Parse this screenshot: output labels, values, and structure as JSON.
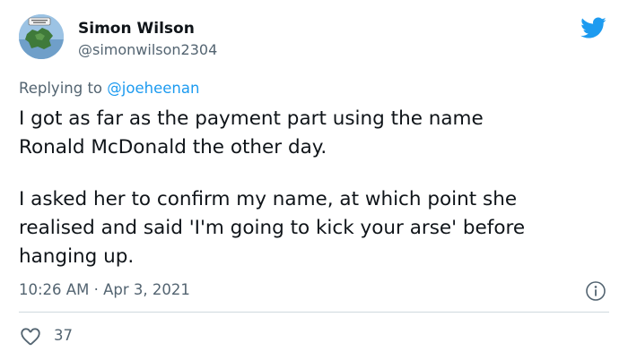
{
  "author": {
    "display_name": "Simon Wilson",
    "handle": "@simonwilson2304"
  },
  "reply": {
    "prefix": "Replying to",
    "mention": "@joeheenan"
  },
  "body": {
    "lines": [
      "I got as far as the payment part using the name",
      "Ronald McDonald the other day.",
      "I asked her to confirm my name, at which point she",
      "realised and said 'I'm going to kick your arse' before",
      "hanging up."
    ]
  },
  "meta": {
    "time": "10:26 AM",
    "separator": "·",
    "date": "Apr 3, 2021"
  },
  "stats": {
    "likes": "37"
  },
  "icons": {
    "brand": "twitter-bird-icon",
    "info": "info-icon",
    "like": "heart-icon"
  },
  "colors": {
    "brand": "#1d9bf0",
    "text": "#0f1419",
    "secondary": "#536471",
    "divider": "#cfd9de"
  }
}
